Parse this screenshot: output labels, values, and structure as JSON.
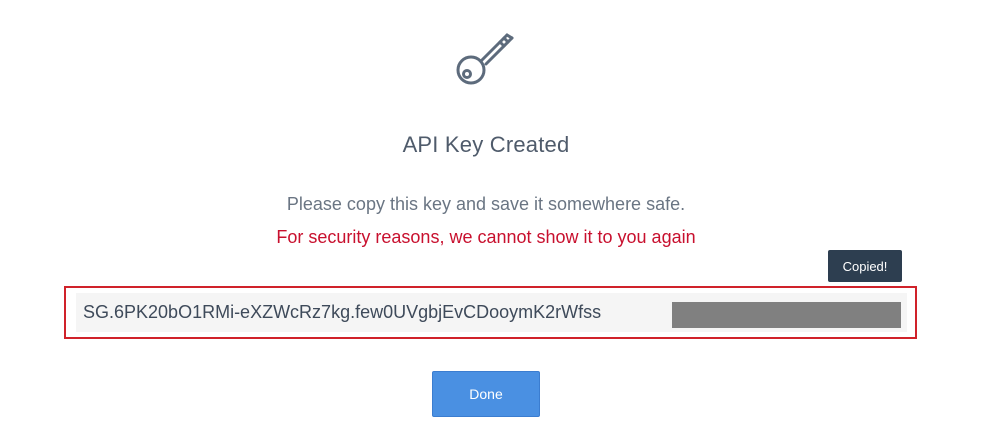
{
  "modal": {
    "icon": "key-icon",
    "title": "API Key Created",
    "subtitle": "Please copy this key and save it somewhere safe.",
    "warning": "For security reasons, we cannot show it to you again",
    "tooltip": "Copied!",
    "api_key_visible": "SG.6PK20bO1RMi-eXZWcRz7kg.few0UVgbjEvCDooymK2rWfss",
    "done_label": "Done"
  },
  "colors": {
    "title": "#4f5b6b",
    "warning": "#c8102e",
    "highlight_border": "#d0222a",
    "tooltip_bg": "#2d3e50",
    "button_bg": "#4a90e2",
    "redaction": "#808080"
  }
}
